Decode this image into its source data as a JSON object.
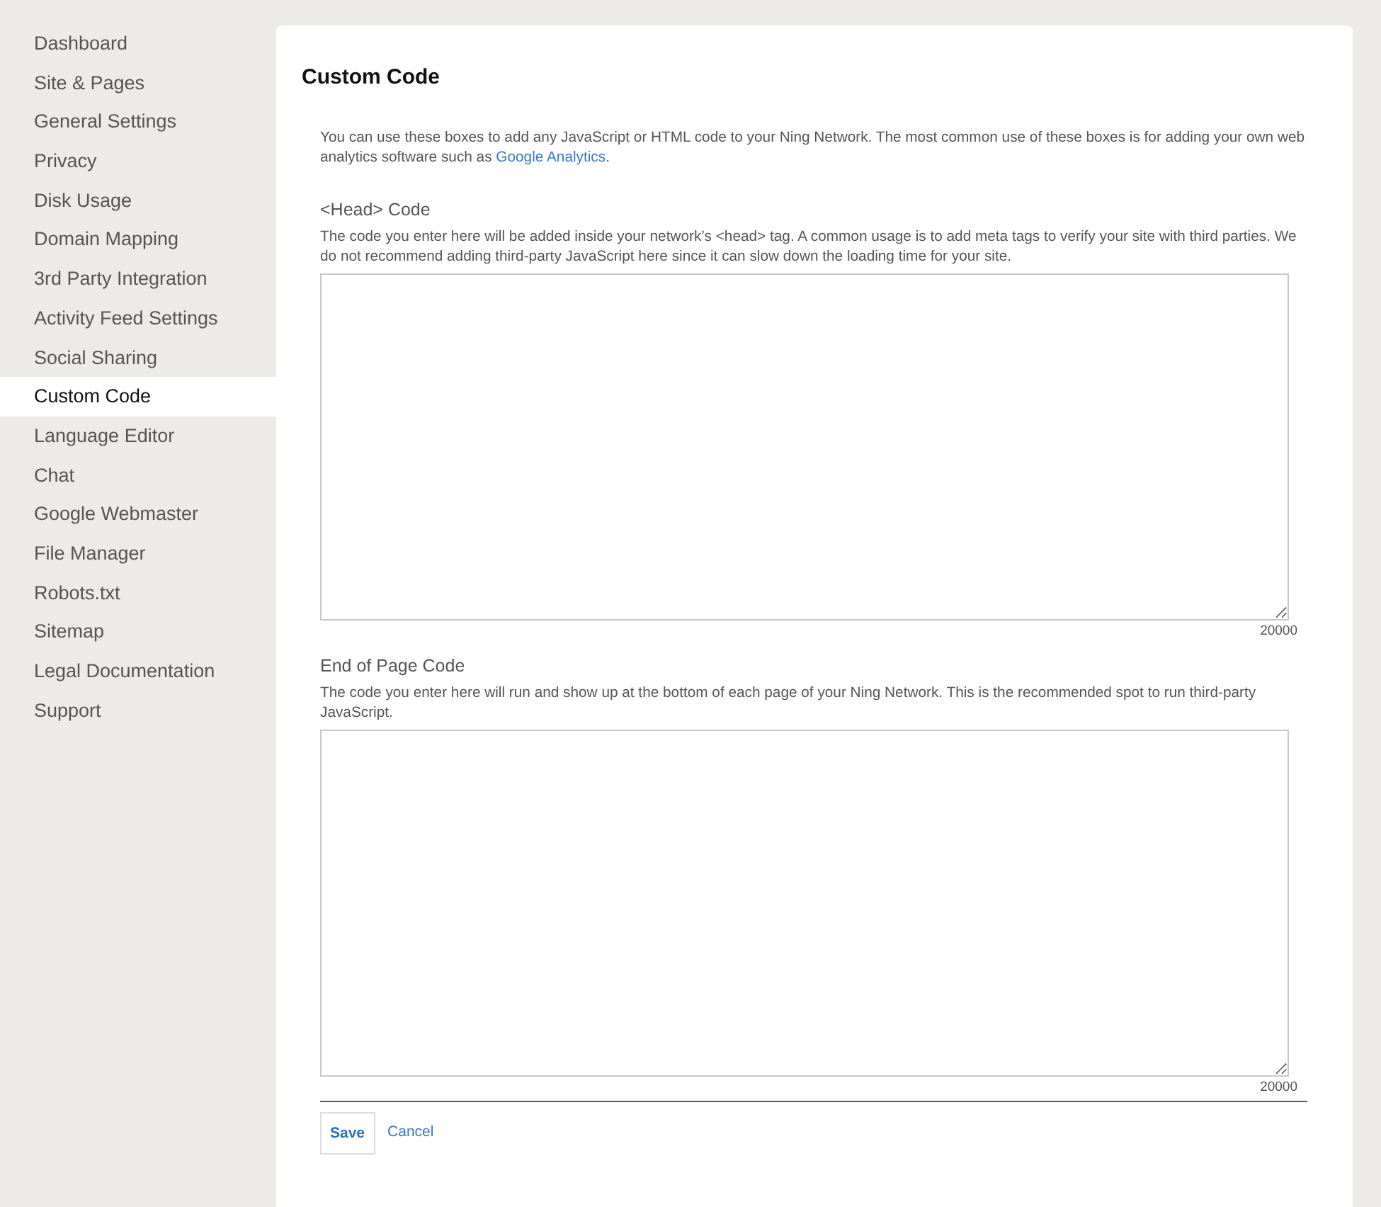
{
  "sidebar": {
    "items": [
      {
        "label": "Dashboard",
        "selected": false
      },
      {
        "label": "Site & Pages",
        "selected": false
      },
      {
        "label": "General Settings",
        "selected": false
      },
      {
        "label": "Privacy",
        "selected": false
      },
      {
        "label": "Disk Usage",
        "selected": false
      },
      {
        "label": "Domain Mapping",
        "selected": false
      },
      {
        "label": "3rd Party Integration",
        "selected": false
      },
      {
        "label": "Activity Feed Settings",
        "selected": false
      },
      {
        "label": "Social Sharing",
        "selected": false
      },
      {
        "label": "Custom Code",
        "selected": true
      },
      {
        "label": "Language Editor",
        "selected": false
      },
      {
        "label": "Chat",
        "selected": false
      },
      {
        "label": "Google Webmaster",
        "selected": false
      },
      {
        "label": "File Manager",
        "selected": false
      },
      {
        "label": "Robots.txt",
        "selected": false
      },
      {
        "label": "Sitemap",
        "selected": false
      },
      {
        "label": "Legal Documentation",
        "selected": false
      },
      {
        "label": "Support",
        "selected": false
      }
    ]
  },
  "page": {
    "title": "Custom Code",
    "intro": {
      "before": "You can use these boxes to add any JavaScript or HTML code to your Ning Network. The most common use of these boxes is for adding your own web analytics software such as ",
      "link": "Google Analytics",
      "after": "."
    },
    "sections": [
      {
        "heading": "<Head> Code",
        "description": "The code you enter here will be added inside your network’s <head> tag. A common usage is to add meta tags to verify your site with third parties. We do not recommend adding third-party JavaScript here since it can slow down the loading time for your site.",
        "counter": "20000"
      },
      {
        "heading": "End of Page Code",
        "description": "The code you enter here will run and show up at the bottom of each page of your Ning Network. This is the recommended spot to run third-party JavaScript.",
        "counter": "20000"
      }
    ],
    "buttons": {
      "save": "Save",
      "cancel": "Cancel"
    }
  }
}
